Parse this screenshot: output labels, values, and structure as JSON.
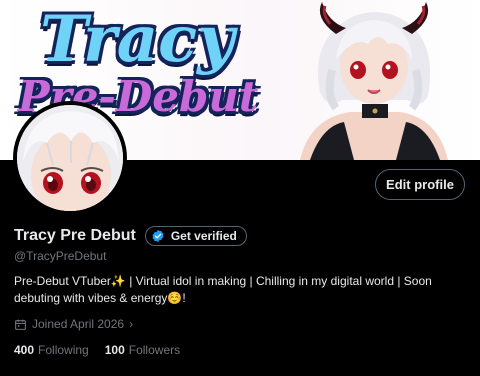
{
  "banner": {
    "title_line1": "Tracy",
    "title_line2": "Pre-Debut"
  },
  "profile": {
    "display_name": "Tracy Pre Debut",
    "handle": "@TracyPreDebut",
    "bio": "Pre-Debut VTuber✨  | Virtual idol in making  | Chilling in my digital world | Soon debuting with vibes & energy☺️!",
    "joined": "Joined April 2026",
    "following_count": "400",
    "following_label": "Following",
    "followers_count": "100",
    "followers_label": "Followers"
  },
  "buttons": {
    "edit_profile": "Edit profile",
    "get_verified": "Get verified"
  },
  "colors": {
    "background": "#000000",
    "text_primary": "#e7e9ea",
    "text_secondary": "#71767b",
    "border": "#536471",
    "verified_blue": "#1d9bf0"
  },
  "icons": {
    "verified": "verified-badge-icon",
    "calendar": "calendar-icon",
    "chevron": "chevron-right-icon"
  }
}
